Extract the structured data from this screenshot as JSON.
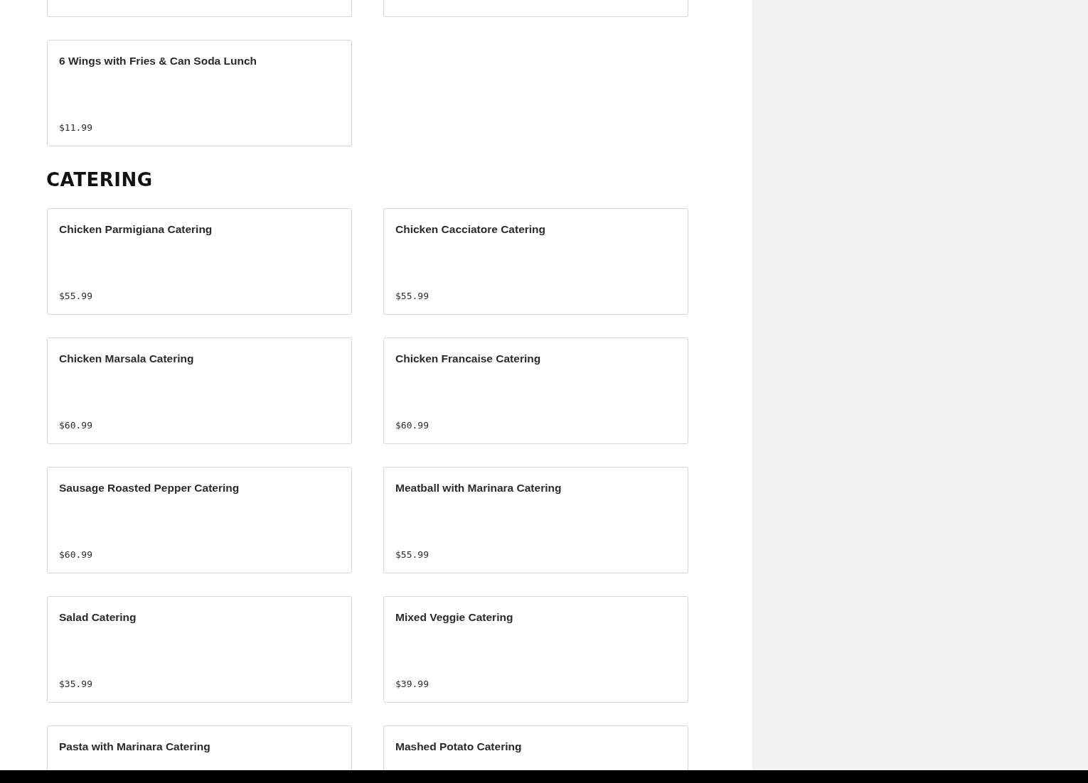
{
  "sections": [
    {
      "items": [
        {
          "name": "6 Wings with Fries & Can Soda Lunch",
          "price": "$11.99"
        }
      ]
    },
    {
      "title": "CATERING",
      "items": [
        {
          "name": "Chicken Parmigiana Catering",
          "price": "$55.99"
        },
        {
          "name": "Chicken Cacciatore Catering",
          "price": "$55.99"
        },
        {
          "name": "Chicken Marsala Catering",
          "price": "$60.99"
        },
        {
          "name": "Chicken Francaise Catering",
          "price": "$60.99"
        },
        {
          "name": "Sausage Roasted Pepper Catering",
          "price": "$60.99"
        },
        {
          "name": "Meatball with Marinara Catering",
          "price": "$55.99"
        },
        {
          "name": "Salad Catering",
          "price": "$35.99"
        },
        {
          "name": "Mixed Veggie Catering",
          "price": "$39.99"
        },
        {
          "name": "Pasta with Marinara Catering"
        },
        {
          "name": "Mashed Potato Catering"
        }
      ]
    }
  ]
}
